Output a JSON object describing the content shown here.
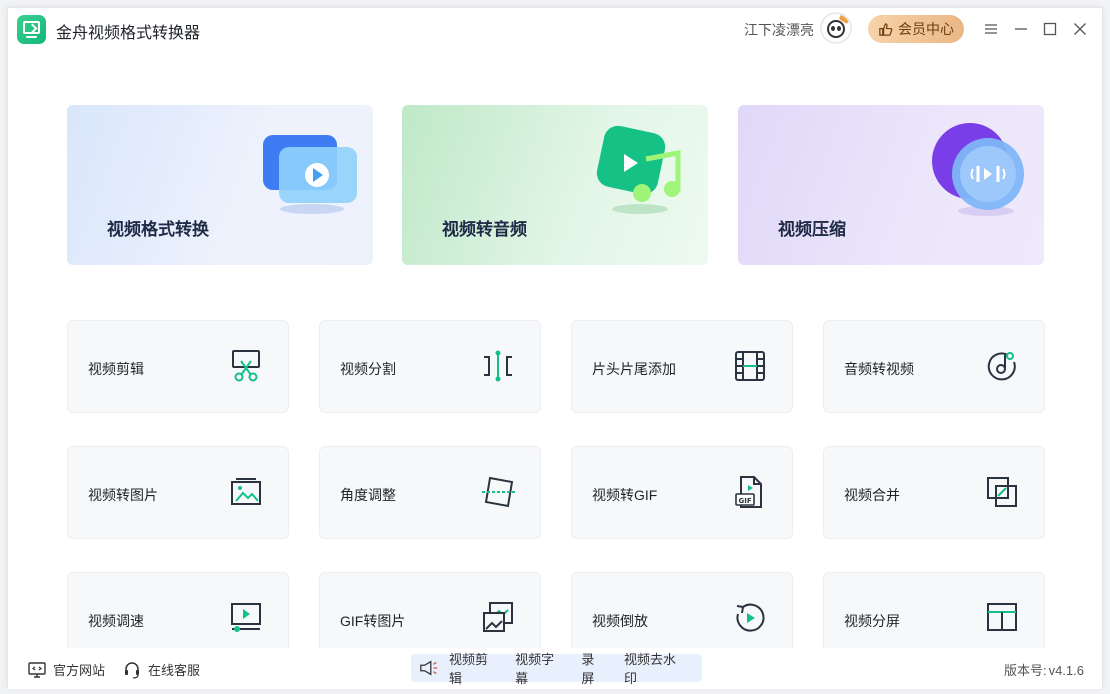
{
  "app": {
    "title": "金舟视频格式转换器"
  },
  "user": {
    "name": "江下凌漂亮"
  },
  "header": {
    "vip_label": "会员中心"
  },
  "features": [
    {
      "label": "视频格式转换",
      "icon": "video-convert-icon"
    },
    {
      "label": "视频转音频",
      "icon": "video-to-audio-icon"
    },
    {
      "label": "视频压缩",
      "icon": "video-compress-icon"
    }
  ],
  "tools": [
    {
      "label": "视频剪辑",
      "icon": "scissors-screen-icon"
    },
    {
      "label": "视频分割",
      "icon": "split-icon"
    },
    {
      "label": "片头片尾添加",
      "icon": "film-strip-icon"
    },
    {
      "label": "音频转视频",
      "icon": "music-disc-icon"
    },
    {
      "label": "视频转图片",
      "icon": "image-icon"
    },
    {
      "label": "角度调整",
      "icon": "rotate-frame-icon"
    },
    {
      "label": "视频转GIF",
      "icon": "gif-file-icon"
    },
    {
      "label": "视频合并",
      "icon": "merge-icon"
    },
    {
      "label": "视频调速",
      "icon": "speed-icon"
    },
    {
      "label": "GIF转图片",
      "icon": "gif-to-image-icon"
    },
    {
      "label": "视频倒放",
      "icon": "reverse-play-icon"
    },
    {
      "label": "视频分屏",
      "icon": "split-screen-icon"
    }
  ],
  "footer": {
    "website": "官方网站",
    "support": "在线客服",
    "promo_links": [
      "视频剪辑",
      "视频字幕",
      "录屏",
      "视频去水印"
    ],
    "version_label": "版本号:",
    "version": "v4.1.6"
  },
  "colors": {
    "accent": "#13c08a",
    "vip": "#eab785",
    "icon_dark": "#2b3340"
  }
}
